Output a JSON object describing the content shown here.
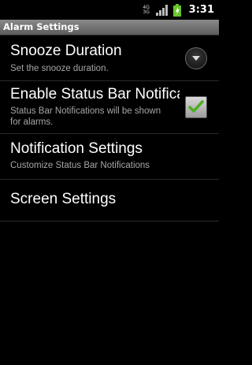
{
  "status_bar": {
    "network_top": "4G",
    "network_bottom": "3G",
    "time": "3:31",
    "icons": [
      "network-type-icon",
      "signal-strength-icon",
      "battery-charging-icon"
    ]
  },
  "title_bar": {
    "title": "Alarm Settings",
    "color": "#6e6e6e"
  },
  "preferences": {
    "snooze": {
      "title": "Snooze Duration",
      "summary": "Set the snooze duration.",
      "icon": "chevron-down-icon"
    },
    "status_bar_notifications": {
      "title": "Enable Status Bar Notifications",
      "summary_line1": "Status Bar Notifications will be shown",
      "summary_line2": "for alarms.",
      "checked": true,
      "check_color": "#4caf1e"
    },
    "notification_settings": {
      "title": "Notification Settings",
      "summary": "Customize Status Bar Notifications"
    },
    "screen_settings": {
      "title": "Screen Settings"
    }
  }
}
